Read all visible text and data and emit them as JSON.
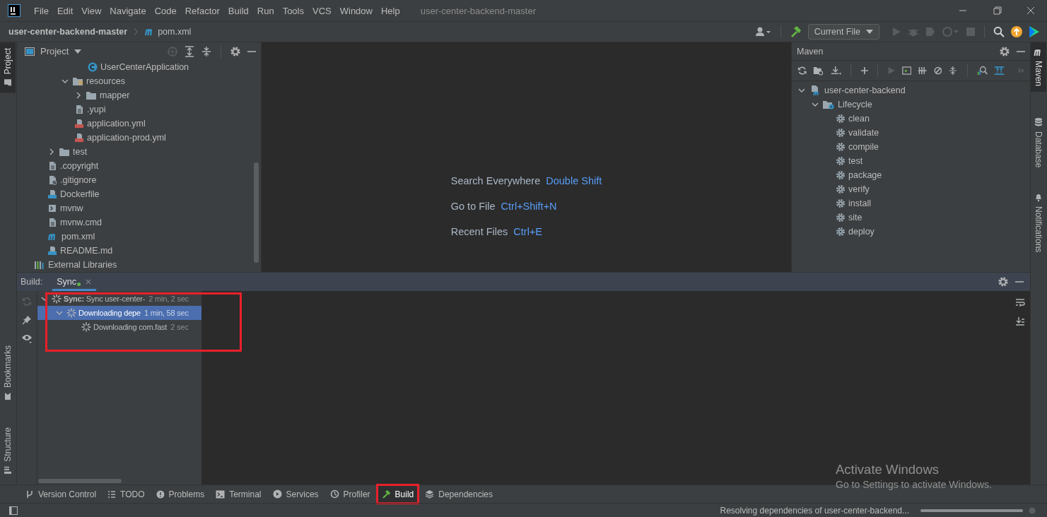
{
  "menu_bar": {
    "items": [
      "File",
      "Edit",
      "View",
      "Navigate",
      "Code",
      "Refactor",
      "Build",
      "Run",
      "Tools",
      "VCS",
      "Window",
      "Help"
    ],
    "project_title": "user-center-backend-master"
  },
  "nav_bar": {
    "breadcrumbs": [
      {
        "label": "user-center-backend-master",
        "kind": "project"
      },
      {
        "label": "pom.xml",
        "kind": "maven"
      }
    ],
    "run_config": "Current File"
  },
  "left_stripe": [
    {
      "label": "Project",
      "selected": true,
      "kind": "project"
    },
    {
      "label": "Bookmarks",
      "selected": false,
      "kind": "bookmark"
    },
    {
      "label": "Structure",
      "selected": false,
      "kind": "structure"
    }
  ],
  "right_stripe": [
    {
      "label": "Maven",
      "selected": true,
      "kind": "maven"
    },
    {
      "label": "Database",
      "selected": false,
      "kind": "database"
    },
    {
      "label": "Notifications",
      "selected": false,
      "kind": "bell"
    }
  ],
  "project_panel": {
    "title": "Project",
    "tree": [
      {
        "children": [
          {
            "children": [
              {
                "children": [
                  {
                    "children": [
                      {
                        "label": "UserCenterApplication",
                        "kind": "class"
                      }
                    ]
                  }
                ]
              },
              {
                "label": "resources",
                "kind": "resources-folder",
                "expanded": true,
                "children": [
                  {
                    "label": "mapper",
                    "kind": "folder",
                    "expanded": false
                  },
                  {
                    "label": ".yupi",
                    "kind": "text-file"
                  },
                  {
                    "label": "application.yml",
                    "kind": "yaml"
                  },
                  {
                    "label": "application-prod.yml",
                    "kind": "yaml"
                  }
                ]
              }
            ]
          },
          {
            "label": "test",
            "kind": "folder",
            "expanded": false
          },
          {
            "label": ".copyright",
            "kind": "text-file"
          },
          {
            "label": ".gitignore",
            "kind": "ignore"
          },
          {
            "label": "Dockerfile",
            "kind": "docker"
          },
          {
            "label": "mvnw",
            "kind": "script"
          },
          {
            "label": "mvnw.cmd",
            "kind": "text-file"
          },
          {
            "label": "pom.xml",
            "kind": "maven"
          },
          {
            "label": "README.md",
            "kind": "markdown"
          }
        ]
      },
      {
        "label": "External Libraries",
        "kind": "libraries"
      }
    ]
  },
  "editor_hints": [
    {
      "action": "Search Everywhere",
      "shortcut": "Double Shift"
    },
    {
      "action": "Go to File",
      "shortcut": "Ctrl+Shift+N"
    },
    {
      "action": "Recent Files",
      "shortcut": "Ctrl+E"
    }
  ],
  "maven_panel": {
    "title": "Maven",
    "tree": [
      {
        "label": "user-center-backend",
        "kind": "maven-project",
        "expanded": true,
        "children": [
          {
            "label": "Lifecycle",
            "kind": "lifecycle",
            "expanded": true,
            "children": [
              {
                "label": "clean",
                "kind": "goal"
              },
              {
                "label": "validate",
                "kind": "goal"
              },
              {
                "label": "compile",
                "kind": "goal"
              },
              {
                "label": "test",
                "kind": "goal"
              },
              {
                "label": "package",
                "kind": "goal"
              },
              {
                "label": "verify",
                "kind": "goal"
              },
              {
                "label": "install",
                "kind": "goal"
              },
              {
                "label": "site",
                "kind": "goal"
              },
              {
                "label": "deploy",
                "kind": "goal"
              }
            ]
          }
        ]
      }
    ]
  },
  "build_panel": {
    "label": "Build:",
    "tabs": [
      {
        "label": "Sync",
        "selected": true
      }
    ],
    "highlighted": true,
    "tree": [
      {
        "label": "**Sync:** Sync user-center-",
        "time": "2 min, 2 sec",
        "kind": "spinner",
        "expanded": true,
        "selected": false,
        "children": [
          {
            "label": "Downloading depe",
            "time": "1 min, 58 sec",
            "kind": "spinner",
            "expanded": true,
            "selected": true,
            "children": [
              {
                "label": "Downloading com.fast",
                "time": "2 sec",
                "kind": "spinner",
                "selected": false
              }
            ]
          }
        ]
      }
    ]
  },
  "tool_windows": [
    {
      "label": "Version Control",
      "kind": "vcs",
      "selected": false,
      "highlighted": false
    },
    {
      "label": "TODO",
      "kind": "todo",
      "selected": false,
      "highlighted": false
    },
    {
      "label": "Problems",
      "kind": "problems",
      "selected": false,
      "highlighted": false
    },
    {
      "label": "Terminal",
      "kind": "terminal",
      "selected": false,
      "highlighted": false
    },
    {
      "label": "Services",
      "kind": "services",
      "selected": false,
      "highlighted": false
    },
    {
      "label": "Profiler",
      "kind": "profiler",
      "selected": false,
      "highlighted": false
    },
    {
      "label": "Build",
      "kind": "build",
      "selected": true,
      "highlighted": true
    },
    {
      "label": "Dependencies",
      "kind": "dependencies",
      "selected": false,
      "highlighted": false
    }
  ],
  "status_bar": {
    "message": "Resolving dependencies of user-center-backend...",
    "progress": {
      "level": 1
    }
  },
  "os_overlay": {
    "title": "Activate Windows",
    "subtitle": "Go to Settings to activate Windows."
  }
}
